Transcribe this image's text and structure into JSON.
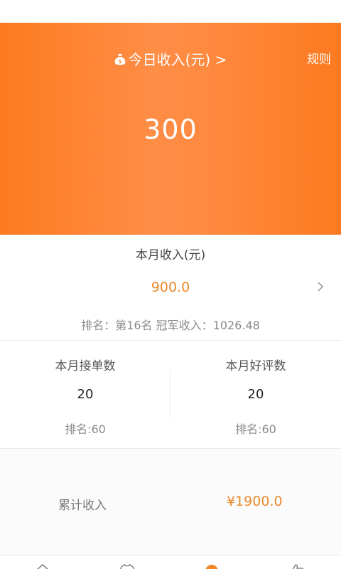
{
  "hero": {
    "title": "今日收入(元) >",
    "rules_label": "规则",
    "today_income": "300"
  },
  "month": {
    "label": "本月收入(元)",
    "income": "900.0",
    "rank_text": "排名：第16名  冠军收入：1026.48"
  },
  "stats": {
    "orders": {
      "label": "本月接单数",
      "value": "20",
      "rank": "排名:60"
    },
    "reviews": {
      "label": "本月好评数",
      "value": "20",
      "rank": "排名:60"
    }
  },
  "total": {
    "label": "累计收入",
    "value": "¥1900.0"
  },
  "tabbar": {
    "icons": [
      "home-icon",
      "shirt-icon",
      "dot-icon",
      "thumb-icon"
    ]
  },
  "colors": {
    "accent": "#fd7a1f",
    "value_orange": "#e98a2c"
  }
}
